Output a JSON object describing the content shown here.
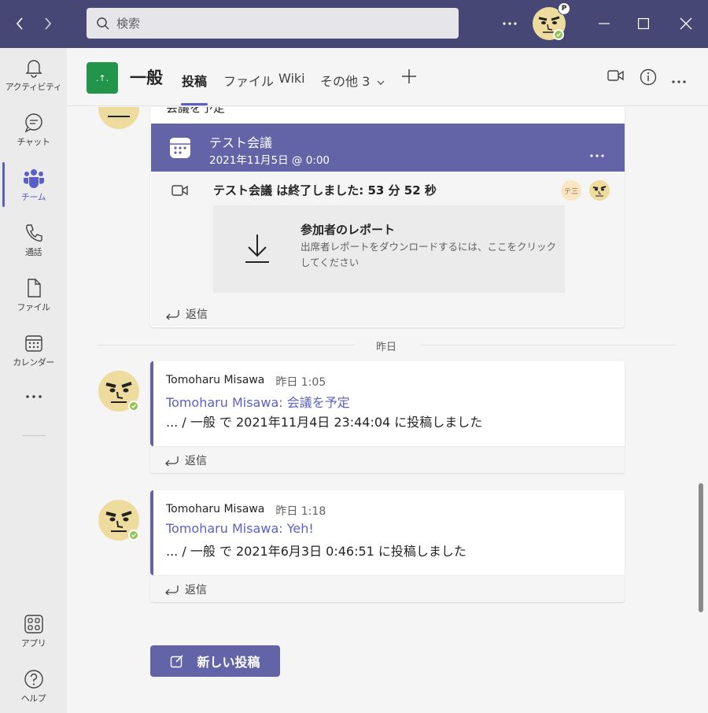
{
  "titlebar": {
    "search_placeholder": "検索",
    "profile_badge": "P"
  },
  "rail": {
    "items": [
      {
        "label": "アクティビティ",
        "icon": "bell-icon"
      },
      {
        "label": "チャット",
        "icon": "chat-icon"
      },
      {
        "label": "チーム",
        "icon": "teams-icon"
      },
      {
        "label": "通話",
        "icon": "phone-icon"
      },
      {
        "label": "ファイル",
        "icon": "file-icon"
      },
      {
        "label": "カレンダー",
        "icon": "calendar-icon"
      }
    ],
    "more": "…",
    "bottom": [
      {
        "label": "アプリ",
        "icon": "apps-icon"
      },
      {
        "label": "ヘルプ",
        "icon": "help-icon"
      }
    ]
  },
  "channel": {
    "team_tile_text": ".↑.",
    "title": "一般",
    "tabs": [
      "投稿",
      "ファイル",
      "Wiki",
      "その他 3"
    ]
  },
  "thread1": {
    "top_partial_text": "会議を予定",
    "meeting_title": "テスト会議",
    "meeting_datetime": "2021年11月5日 @ 0:00",
    "ended_text": "テスト会議 は終了しました: 53 分 52 秒",
    "participant_initials": "テ三",
    "report_title": "参加者のレポート",
    "report_desc": "出席者レポートをダウンロードするには、ここをクリックしてください",
    "reply_label": "返信"
  },
  "day_divider": "昨日",
  "messages": [
    {
      "sender": "Tomoharu Misawa",
      "time": "昨日 1:05",
      "link": "Tomoharu Misawa: 会議を予定",
      "body": "... / 一般 で 2021年11月4日 23:44:04 に投稿しました",
      "reply_label": "返信"
    },
    {
      "sender": "Tomoharu Misawa",
      "time": "昨日 1:18",
      "link": "Tomoharu Misawa: Yeh!",
      "body": "... / 一般 で 2021年6月3日 0:46:51 に投稿しました",
      "reply_label": "返信"
    }
  ],
  "new_post_label": "新しい投稿",
  "colors": {
    "titlebar": "#464775",
    "accent": "#6264a7",
    "brand": "#5b5fc7",
    "team_tile": "#23954b",
    "presence": "#92c353"
  }
}
